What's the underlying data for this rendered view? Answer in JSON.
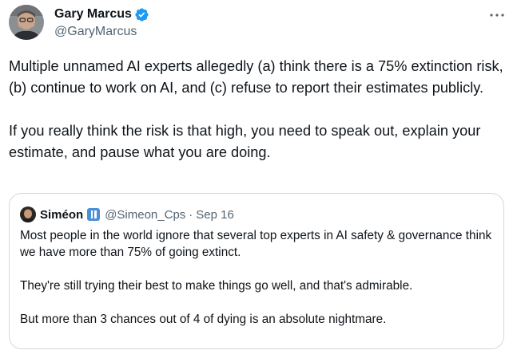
{
  "tweet": {
    "author": {
      "name": "Gary Marcus",
      "handle": "@GaryMarcus",
      "verified": true,
      "verified_color": "#1d9bf0"
    },
    "more_icon": "more-horizontal-icon",
    "paragraphs": [
      "Multiple unnamed AI experts allegedly (a) think there is a 75% extinction risk, (b) continue to work on AI, and (c) refuse to report their estimates publicly.",
      "If you really think the risk is that high, you need to speak out, explain your estimate, and pause what you are doing."
    ]
  },
  "quote": {
    "author": {
      "name": "Siméon",
      "badge_icon": "pause-badge-icon",
      "badge_color": "#4a90d9",
      "handle": "@Simeon_Cps",
      "separator": "·",
      "date": "Sep 16"
    },
    "paragraphs": [
      "Most people in the world ignore that several top experts in AI safety & governance think we have more than 75% of going extinct.",
      "They're still trying their best to make things go well, and that's admirable.",
      "But more than 3 chances out of 4 of dying is an absolute nightmare."
    ]
  }
}
